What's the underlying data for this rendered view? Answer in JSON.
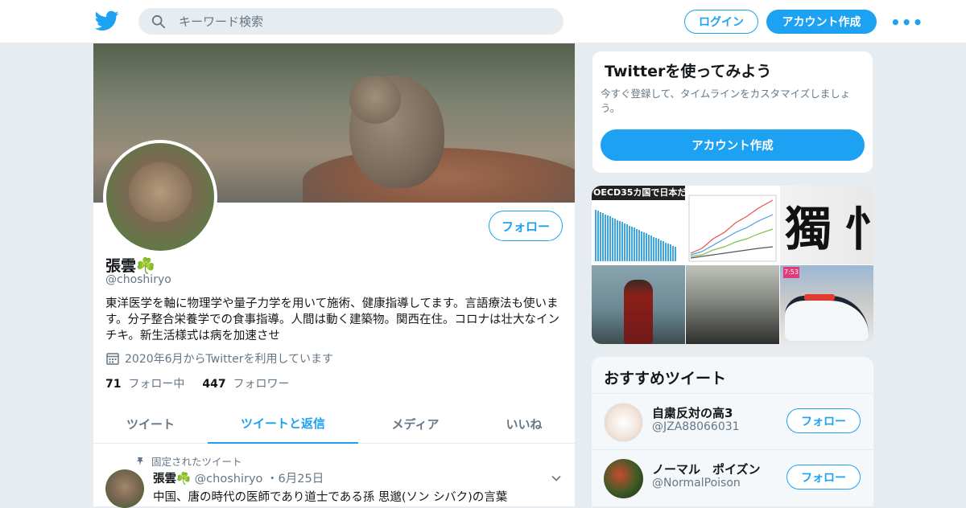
{
  "header": {
    "search_placeholder": "キーワード検索",
    "login_label": "ログイン",
    "signup_label": "アカウント作成",
    "more_label": "•••"
  },
  "profile": {
    "name": "張雲☘️",
    "handle": "@choshiryo",
    "follow_label": "フォロー",
    "bio": "東洋医学を軸に物理学や量子力学を用いて施術、健康指導してます。言語療法も使います。分子整合栄養学での食事指導。人間は動く建築物。関西在住。コロナは壮大なインチキ。新生活様式は病を加速させ",
    "joined": "2020年6月からTwitterを利用しています",
    "following_count": "71",
    "following_label": "フォロー中",
    "followers_count": "447",
    "followers_label": "フォロワー"
  },
  "tabs": [
    {
      "label": "ツイート",
      "active": false
    },
    {
      "label": "ツイートと返信",
      "active": true
    },
    {
      "label": "メディア",
      "active": false
    },
    {
      "label": "いいね",
      "active": false
    }
  ],
  "pinned_tweet": {
    "pinned_label": "固定されたツイート",
    "author": "張雲☘️",
    "handle": "@choshiryo",
    "date": "6月25日",
    "text": "中国、唐の時代の医師であり道士である孫 思邈(ソン シバク)の言葉"
  },
  "signup_card": {
    "title": "Twitterを使ってみよう",
    "description": "今すぐ登録して、タイムラインをカスタマイズしましょう。",
    "button_label": "アカウント作成"
  },
  "media": {
    "chart_caption": "OECD35カ国で日本だ",
    "calligraphy": [
      "獨",
      "忄"
    ],
    "tag": "7:53"
  },
  "recommendations": {
    "title": "おすすめツイート",
    "follow_label": "フォロー",
    "items": [
      {
        "name": "自粛反対の高3",
        "handle": "@JZA88066031"
      },
      {
        "name": "ノーマル　ポイズン",
        "handle": "@NormalPoison"
      }
    ]
  },
  "colors": {
    "brand": "#1da1f2",
    "secondary_text": "#657786",
    "background": "#e6ecf0"
  }
}
